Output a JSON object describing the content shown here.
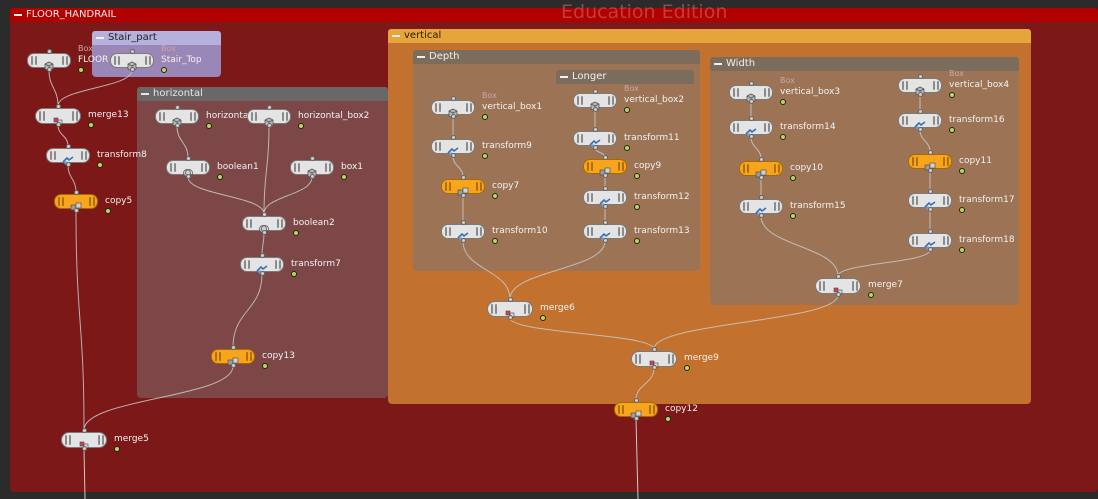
{
  "watermark": "Education Edition",
  "frames": {
    "floor_handrail": "FLOOR_HANDRAIL",
    "stair_part": "Stair_part",
    "horizontal": "horizontal",
    "vertical": "vertical",
    "depth": "Depth",
    "longer": "Longer",
    "width": "Width"
  },
  "colors": {
    "floor_handrail_bg": "#7d1818",
    "floor_handrail_title": "#b00000",
    "stair_part_bg": "#9a86b7",
    "stair_part_title": "#b6b0dc",
    "horizontal_bg": "#7e4a4a",
    "horizontal_title": "#6c6c6c",
    "vertical_bg": "#c2722e",
    "vertical_title": "#e6a53a",
    "subnet_bg": "#9c7455",
    "subnet_title": "#7c6c5c",
    "copy_node": "#f6a51c",
    "wire": "#c9c9c9"
  },
  "nodes": [
    {
      "id": "floor",
      "label": "FLOOR",
      "type": "Box",
      "kind": "box",
      "name": "node-floor"
    },
    {
      "id": "stair_top",
      "label": "Stair_Top",
      "type": "Box",
      "kind": "box",
      "name": "node-stair-top"
    },
    {
      "id": "merge13",
      "label": "merge13",
      "kind": "merge",
      "name": "node-merge13"
    },
    {
      "id": "transform8",
      "label": "transform8",
      "kind": "transform",
      "name": "node-transform8"
    },
    {
      "id": "copy5",
      "label": "copy5",
      "kind": "copy",
      "name": "node-copy5"
    },
    {
      "id": "horizontal",
      "label": "horizontal",
      "kind": "box",
      "name": "node-horizontal"
    },
    {
      "id": "horizontal_box2",
      "label": "horizontal_box2",
      "kind": "box",
      "name": "node-horizontal-box2"
    },
    {
      "id": "boolean1",
      "label": "boolean1",
      "kind": "boolean",
      "name": "node-boolean1"
    },
    {
      "id": "box1",
      "label": "box1",
      "kind": "box",
      "name": "node-box1"
    },
    {
      "id": "boolean2",
      "label": "boolean2",
      "kind": "boolean",
      "name": "node-boolean2"
    },
    {
      "id": "transform7",
      "label": "transform7",
      "kind": "transform",
      "name": "node-transform7"
    },
    {
      "id": "copy13",
      "label": "copy13",
      "kind": "copy",
      "name": "node-copy13"
    },
    {
      "id": "merge5",
      "label": "merge5",
      "kind": "merge",
      "name": "node-merge5"
    },
    {
      "id": "vertical_box1",
      "label": "vertical_box1",
      "type": "Box",
      "kind": "box",
      "name": "node-vertical-box1"
    },
    {
      "id": "transform9",
      "label": "transform9",
      "kind": "transform",
      "name": "node-transform9"
    },
    {
      "id": "copy7",
      "label": "copy7",
      "kind": "copy",
      "name": "node-copy7"
    },
    {
      "id": "transform10",
      "label": "transform10",
      "kind": "transform",
      "name": "node-transform10"
    },
    {
      "id": "vertical_box2",
      "label": "vertical_box2",
      "type": "Box",
      "kind": "box",
      "name": "node-vertical-box2"
    },
    {
      "id": "transform11",
      "label": "transform11",
      "kind": "transform",
      "name": "node-transform11"
    },
    {
      "id": "copy9",
      "label": "copy9",
      "kind": "copy",
      "name": "node-copy9"
    },
    {
      "id": "transform12",
      "label": "transform12",
      "kind": "transform",
      "name": "node-transform12"
    },
    {
      "id": "transform13",
      "label": "transform13",
      "kind": "transform",
      "name": "node-transform13"
    },
    {
      "id": "merge6",
      "label": "merge6",
      "kind": "merge",
      "name": "node-merge6"
    },
    {
      "id": "vertical_box3",
      "label": "vertical_box3",
      "type": "Box",
      "kind": "box",
      "name": "node-vertical-box3"
    },
    {
      "id": "transform14",
      "label": "transform14",
      "kind": "transform",
      "name": "node-transform14"
    },
    {
      "id": "copy10",
      "label": "copy10",
      "kind": "copy",
      "name": "node-copy10"
    },
    {
      "id": "transform15",
      "label": "transform15",
      "kind": "transform",
      "name": "node-transform15"
    },
    {
      "id": "vertical_box4",
      "label": "vertical_box4",
      "type": "Box",
      "kind": "box",
      "name": "node-vertical-box4"
    },
    {
      "id": "transform16",
      "label": "transform16",
      "kind": "transform",
      "name": "node-transform16"
    },
    {
      "id": "copy11",
      "label": "copy11",
      "kind": "copy",
      "name": "node-copy11"
    },
    {
      "id": "transform17",
      "label": "transform17",
      "kind": "transform",
      "name": "node-transform17"
    },
    {
      "id": "transform18",
      "label": "transform18",
      "kind": "transform",
      "name": "node-transform18"
    },
    {
      "id": "merge7",
      "label": "merge7",
      "kind": "merge",
      "name": "node-merge7"
    },
    {
      "id": "merge9",
      "label": "merge9",
      "kind": "merge",
      "name": "node-merge9"
    },
    {
      "id": "copy12",
      "label": "copy12",
      "kind": "copy",
      "name": "node-copy12"
    }
  ],
  "wires": [
    [
      "floor",
      "merge13"
    ],
    [
      "stair_top",
      "merge13"
    ],
    [
      "merge13",
      "transform8"
    ],
    [
      "transform8",
      "copy5"
    ],
    [
      "horizontal",
      "boolean1"
    ],
    [
      "horizontal_box2",
      "boolean2"
    ],
    [
      "boolean1",
      "boolean2"
    ],
    [
      "box1",
      "boolean2"
    ],
    [
      "boolean2",
      "transform7"
    ],
    [
      "transform7",
      "copy13"
    ],
    [
      "copy5",
      "merge5"
    ],
    [
      "copy13",
      "merge5"
    ],
    [
      "vertical_box1",
      "transform9"
    ],
    [
      "transform9",
      "copy7"
    ],
    [
      "copy7",
      "transform10"
    ],
    [
      "transform10",
      "merge6"
    ],
    [
      "vertical_box2",
      "transform11"
    ],
    [
      "transform11",
      "copy9"
    ],
    [
      "copy9",
      "transform12"
    ],
    [
      "transform12",
      "transform13"
    ],
    [
      "transform13",
      "merge6"
    ],
    [
      "vertical_box3",
      "transform14"
    ],
    [
      "transform14",
      "copy10"
    ],
    [
      "copy10",
      "transform15"
    ],
    [
      "transform15",
      "merge7"
    ],
    [
      "vertical_box4",
      "transform16"
    ],
    [
      "transform16",
      "copy11"
    ],
    [
      "copy11",
      "transform17"
    ],
    [
      "transform17",
      "transform18"
    ],
    [
      "transform18",
      "merge7"
    ],
    [
      "merge6",
      "merge9"
    ],
    [
      "merge7",
      "merge9"
    ],
    [
      "merge9",
      "copy12"
    ]
  ]
}
